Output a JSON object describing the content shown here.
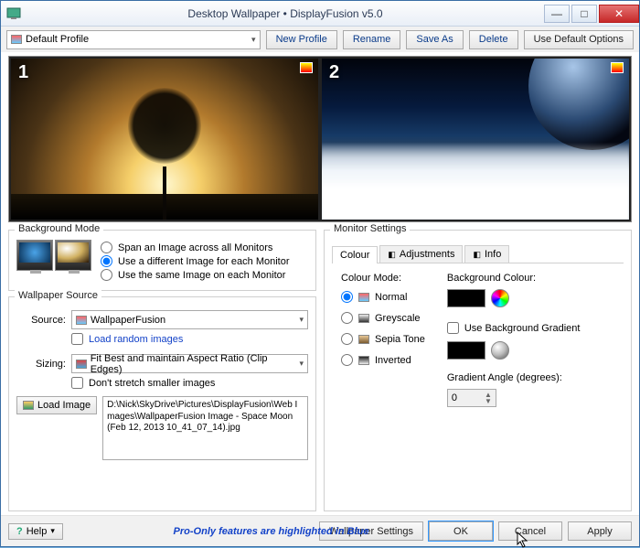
{
  "window": {
    "title": "Desktop Wallpaper • DisplayFusion v5.0"
  },
  "toolbar": {
    "profile_selected": "Default Profile",
    "new_profile": "New Profile",
    "rename": "Rename",
    "save_as": "Save As",
    "delete": "Delete",
    "use_default": "Use Default Options"
  },
  "monitors": {
    "m1_num": "1",
    "m2_num": "2"
  },
  "bgmode": {
    "legend": "Background Mode",
    "opt_span": "Span an Image across all Monitors",
    "opt_diff": "Use a different Image for each Monitor",
    "opt_same": "Use the same Image on each Monitor",
    "selected": "diff"
  },
  "source": {
    "legend": "Wallpaper Source",
    "source_label": "Source:",
    "source_selected": "WallpaperFusion",
    "load_random": "Load random images",
    "sizing_label": "Sizing:",
    "sizing_selected": "Fit Best and maintain Aspect Ratio (Clip Edges)",
    "no_stretch": "Don't stretch smaller images",
    "load_image": "Load Image",
    "path": "D:\\Nick\\SkyDrive\\Pictures\\DisplayFusion\\Web Images\\WallpaperFusion Image - Space Moon (Feb 12, 2013 10_41_07_14).jpg"
  },
  "monitor_settings": {
    "legend": "Monitor Settings",
    "tab_colour": "Colour",
    "tab_adjustments": "Adjustments",
    "tab_info": "Info",
    "colour_mode_label": "Colour Mode:",
    "opt_normal": "Normal",
    "opt_grey": "Greyscale",
    "opt_sepia": "Sepia Tone",
    "opt_inverted": "Inverted",
    "bgcolour_label": "Background Colour:",
    "use_gradient": "Use Background Gradient",
    "grad_angle_label": "Gradient Angle (degrees):",
    "grad_angle_value": "0"
  },
  "footer": {
    "help": "Help",
    "pro_msg": "Pro-Only features are highlighted in Blue",
    "wallpaper_settings": "Wallpaper Settings",
    "ok": "OK",
    "cancel": "Cancel",
    "apply": "Apply"
  }
}
